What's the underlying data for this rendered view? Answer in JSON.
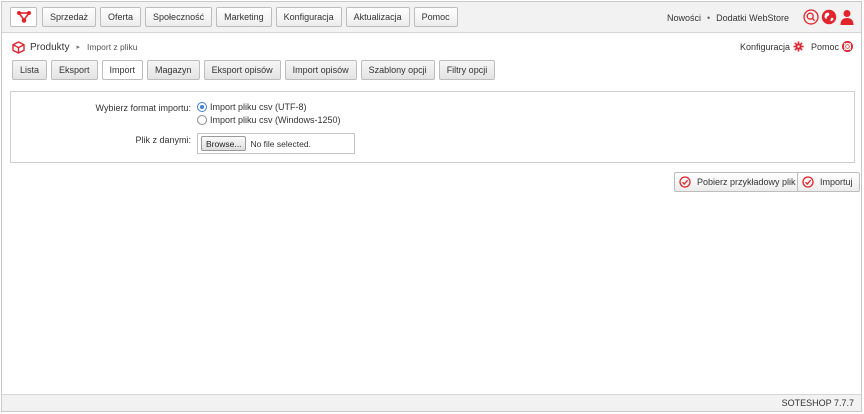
{
  "colors": {
    "accent": "#e2242c",
    "radio_selected": "#3c7fd6"
  },
  "icons": {
    "logo": "network-logo-icon",
    "search": "search-icon",
    "globe": "globe-icon",
    "user": "user-icon",
    "breadcrumb": "cube-icon",
    "config": "gear-icon",
    "help": "lifebuoy-icon",
    "action": "check-circle-icon"
  },
  "nav": {
    "items": [
      "Sprzedaż",
      "Oferta",
      "Społeczność",
      "Marketing",
      "Konfiguracja",
      "Aktualizacja",
      "Pomoc"
    ]
  },
  "top_links": {
    "news": "Nowości",
    "separator": "•",
    "addons": "Dodatki WebStore"
  },
  "breadcrumb": {
    "section": "Produkty",
    "separator": "▸",
    "page": "Import z pliku"
  },
  "header_links": {
    "config": "Konfiguracja",
    "help": "Pomoc"
  },
  "tabs": {
    "items": [
      "Lista",
      "Eksport",
      "Import",
      "Magazyn",
      "Eksport opisów",
      "Import opisów",
      "Szablony opcji",
      "Filtry opcji"
    ],
    "active": "Import"
  },
  "form": {
    "format_label": "Wybierz format importu:",
    "format_options": [
      "Import pliku csv (UTF-8)",
      "Import pliku csv (Windows-1250)"
    ],
    "format_selected": "Import pliku csv (UTF-8)",
    "file_label": "Plik z danymi:",
    "browse_label": "Browse...",
    "file_status": "No file selected."
  },
  "actions": {
    "sample": "Pobierz przykładowy plik",
    "import": "Importuj"
  },
  "footer": {
    "version": "SOTESHOP 7.7.7"
  }
}
